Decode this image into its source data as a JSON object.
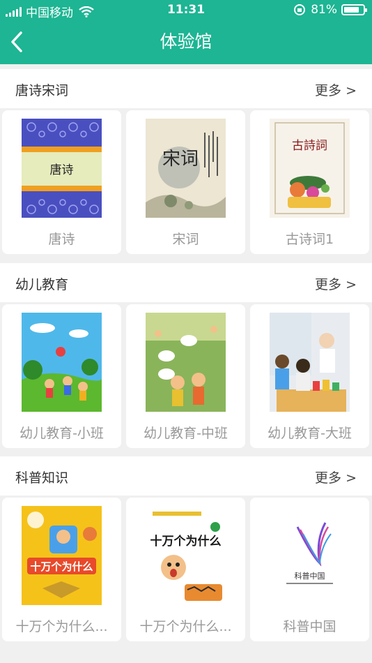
{
  "status_bar": {
    "carrier": "中国移动",
    "time": "11:31",
    "battery": "81%",
    "battery_level": 0.81
  },
  "nav": {
    "title": "体验馆",
    "back_icon": "chevron-left-icon"
  },
  "more_label": "更多 >",
  "sections": [
    {
      "title": "唐诗宋词",
      "items": [
        {
          "label": "唐诗",
          "cover_text": "唐诗"
        },
        {
          "label": "宋词",
          "cover_text": "宋词"
        },
        {
          "label": "古诗词1",
          "cover_text": "古詩詞"
        }
      ]
    },
    {
      "title": "幼儿教育",
      "items": [
        {
          "label": "幼儿教育-小班"
        },
        {
          "label": "幼儿教育-中班"
        },
        {
          "label": "幼儿教育-大班"
        }
      ]
    },
    {
      "title": "科普知识",
      "items": [
        {
          "label": "十万个为什么...",
          "cover_text": "十万个为什么"
        },
        {
          "label": "十万个为什么...",
          "cover_text": "十万个为什么"
        },
        {
          "label": "科普中国",
          "cover_text": "科普中国"
        }
      ]
    }
  ],
  "colors": {
    "header": "#1db593",
    "background": "#f0f0f0"
  }
}
